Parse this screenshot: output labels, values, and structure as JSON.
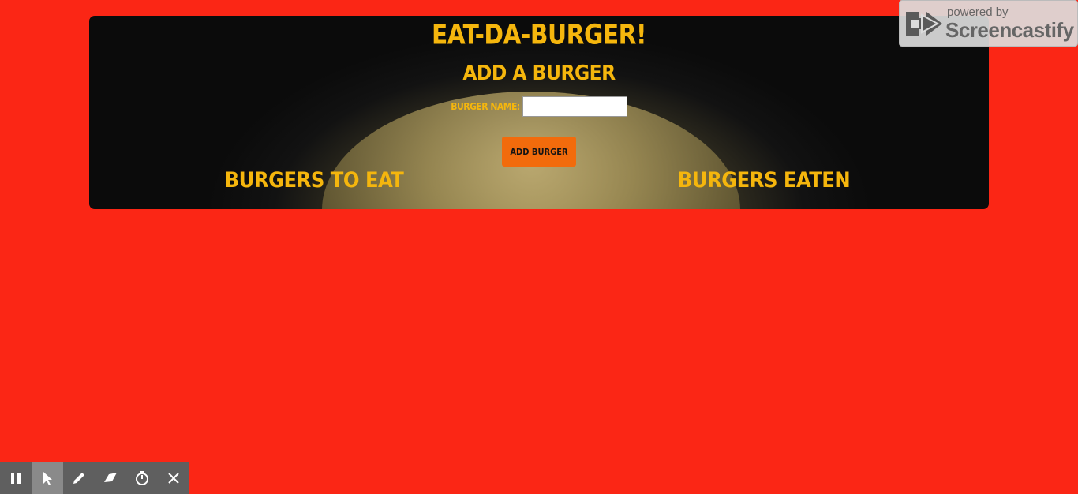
{
  "header": {
    "title": "EAT-DA-BURGER!",
    "subtitle": "ADD A BURGER"
  },
  "form": {
    "label": "BURGER NAME:",
    "input_value": "",
    "input_placeholder": "",
    "button_label": "ADD BURGER"
  },
  "columns": {
    "left_heading": "BURGERS TO EAT",
    "right_heading": "BURGERS EATEN"
  },
  "watermark": {
    "small_text": "powered by",
    "brand_text": "Screencastify"
  },
  "recorder_toolbar": {
    "tools": [
      {
        "icon": "pause-icon"
      },
      {
        "icon": "cursor-icon",
        "active": true
      },
      {
        "icon": "pen-icon"
      },
      {
        "icon": "eraser-icon"
      },
      {
        "icon": "timer-icon"
      },
      {
        "icon": "close-icon"
      }
    ]
  },
  "colors": {
    "page_background": "#fb2615",
    "heading_text": "#f5b60d",
    "button_background": "#f26b0c"
  }
}
